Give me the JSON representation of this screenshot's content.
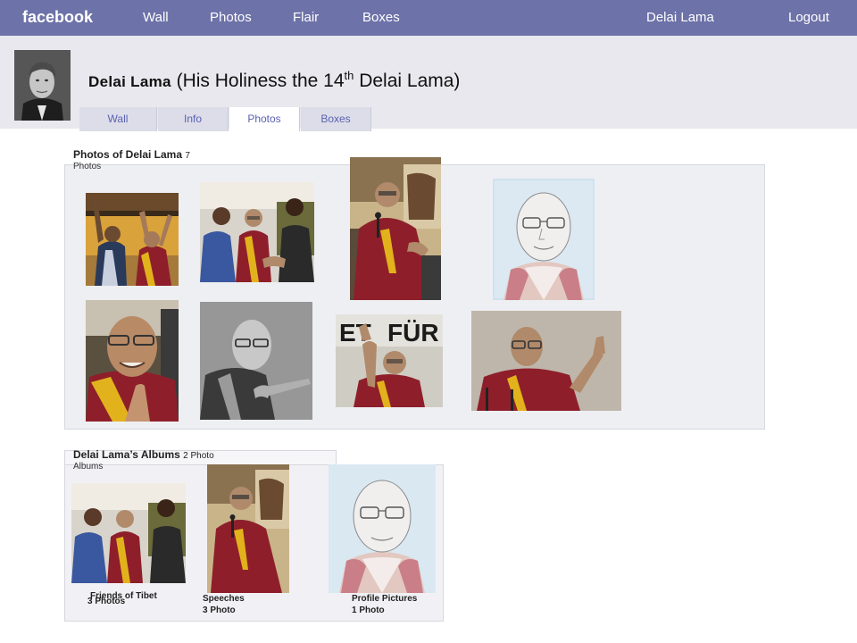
{
  "topbar": {
    "logo": "facebook",
    "nav": [
      "Wall",
      "Photos",
      "Flair",
      "Boxes"
    ],
    "user": "Delai Lama",
    "logout": "Logout"
  },
  "profile": {
    "name": "Delai Lama",
    "subtitle_pre": "(His Holiness the 14",
    "subtitle_sup": "th",
    "subtitle_post": " Delai Lama)"
  },
  "tabs": [
    "Wall",
    "Info",
    "Photos",
    "Boxes"
  ],
  "active_tab": "Photos",
  "photos_section": {
    "title": "Photos of Delai Lama",
    "count": "7",
    "count_label": "Photos"
  },
  "albums_section": {
    "title": "Delai Lama’s Albums",
    "count": "2 Photo",
    "count_label": "Albums",
    "albums": [
      {
        "name": "Friends of Tibet",
        "count": "3 Photos"
      },
      {
        "name": "Speeches",
        "count": "3 Photo"
      },
      {
        "name": "Profile Pictures",
        "count": "1 Photo"
      }
    ]
  },
  "colors": {
    "topbar": "#6d72a8",
    "robe": "#8e1f2a",
    "saffron": "#e2b21c"
  }
}
